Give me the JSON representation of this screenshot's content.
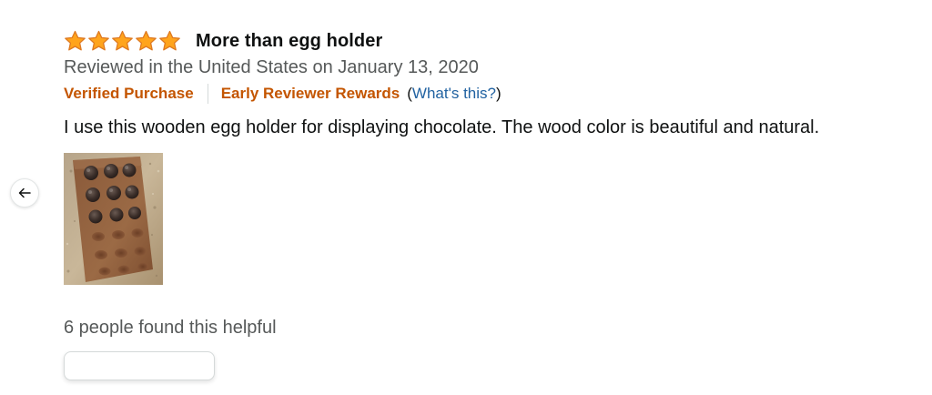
{
  "review": {
    "rating": 5,
    "title": "More than egg holder",
    "date": "Reviewed in the United States on January 13, 2020",
    "verified": "Verified Purchase",
    "early_reviewer": "Early Reviewer Rewards",
    "whats_this_open": "(",
    "whats_this_link": "What's this?",
    "whats_this_close": ")",
    "body": "I use this wooden egg holder for displaying chocolate. The wood color is beautiful and natural.",
    "image_icon": "review-photo-egg-holder",
    "helpful_text": "6 people found this helpful"
  },
  "colors": {
    "star": "#ffa41c",
    "star_stroke": "#de7921",
    "badge": "#c45500",
    "link": "#2162a1",
    "muted": "#565959"
  },
  "icons": {
    "back": "arrow-left-icon",
    "star": "star-icon"
  }
}
